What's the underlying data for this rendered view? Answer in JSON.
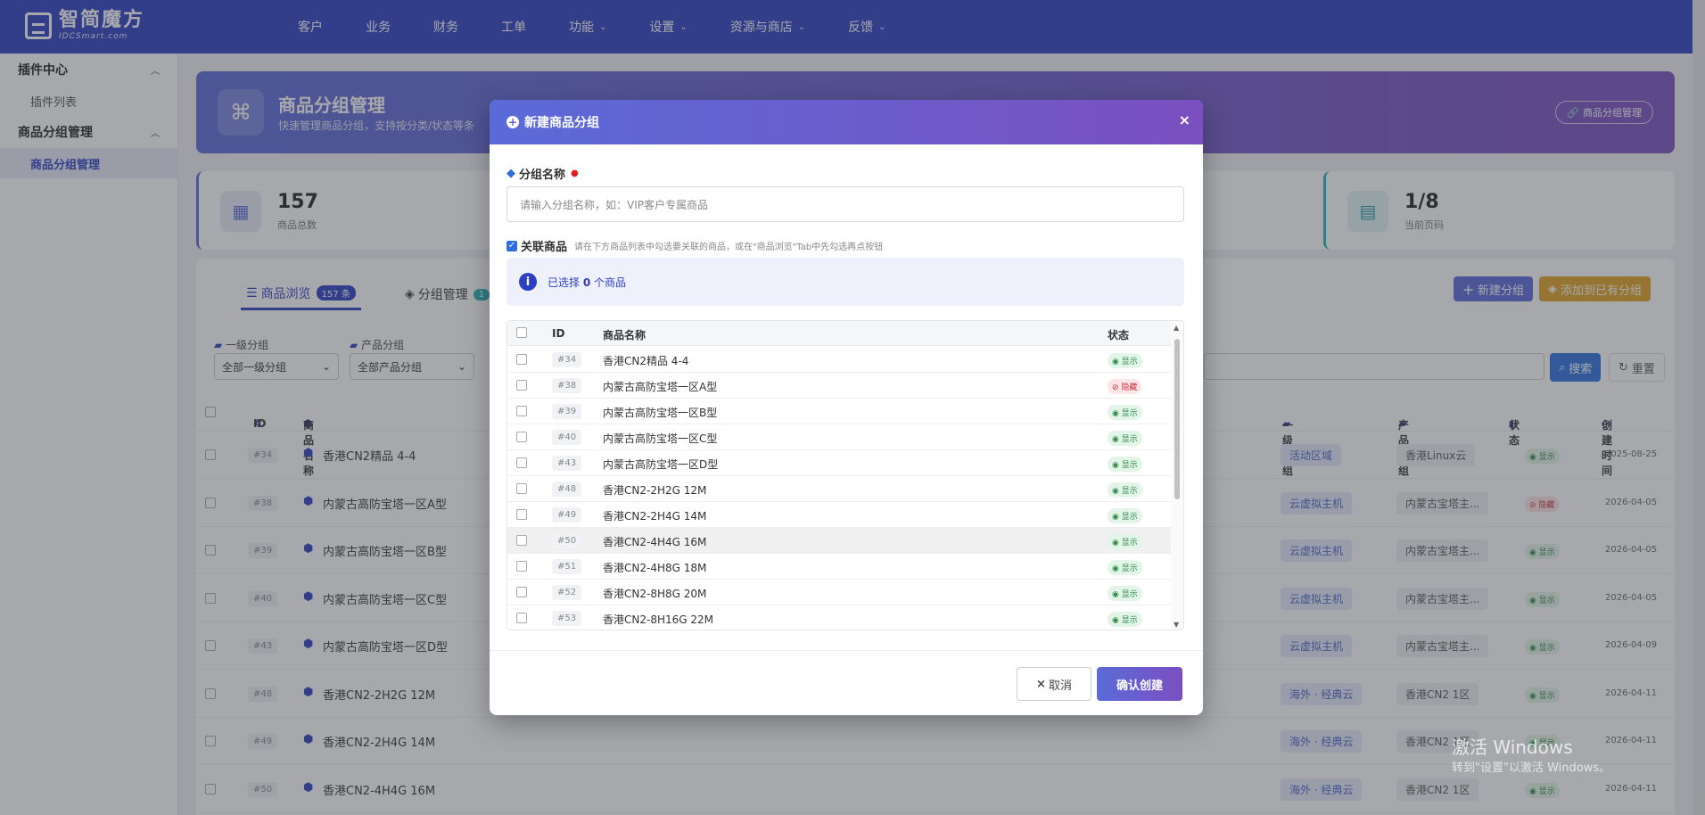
{
  "brand": {
    "name": "智简魔方",
    "sub": "IDCSmart.com"
  },
  "topnav": {
    "items": [
      {
        "label": "客户",
        "has_dropdown": false
      },
      {
        "label": "业务",
        "has_dropdown": false
      },
      {
        "label": "财务",
        "has_dropdown": false
      },
      {
        "label": "工单",
        "has_dropdown": false
      },
      {
        "label": "功能",
        "has_dropdown": true
      },
      {
        "label": "设置",
        "has_dropdown": true
      },
      {
        "label": "资源与商店",
        "has_dropdown": true
      },
      {
        "label": "反馈",
        "has_dropdown": true
      }
    ]
  },
  "sidebar": {
    "groups": [
      {
        "label": "插件中心",
        "items": [
          {
            "label": "插件列表",
            "active": false
          }
        ]
      },
      {
        "label": "商品分组管理",
        "items": [
          {
            "label": "商品分组管理",
            "active": true
          }
        ]
      }
    ]
  },
  "header": {
    "title": "商品分组管理",
    "subtitle": "快速管理商品分组，支持按分类/状态等条",
    "button": "商品分组管理"
  },
  "stats": [
    {
      "value": "157",
      "label": "商品总数"
    },
    {
      "value": "1/8",
      "label": "当前页码"
    }
  ],
  "tabs": [
    {
      "label": "商品浏览",
      "badge": "157 条"
    },
    {
      "label": "分组管理",
      "badge": "1"
    }
  ],
  "actions": {
    "new_group": "新建分组",
    "add_existing": "添加到已有分组"
  },
  "filters": {
    "level1_label": "一级分组",
    "level1_value": "全部一级分组",
    "product_label": "产品分组",
    "product_value": "全部产品分组",
    "search": "搜索",
    "reset": "重置"
  },
  "table": {
    "headers": {
      "id": "ID",
      "name": "商品名称",
      "level1": "一级分组",
      "product_group": "产品分组",
      "status": "状态",
      "created": "创建时间"
    },
    "rows": [
      {
        "id": "#34",
        "name": "香港CN2精品 4-4",
        "level1": "活动区域",
        "product_group": "香港Linux云",
        "status": "显示",
        "created": "2025-08-25"
      },
      {
        "id": "#38",
        "name": "内蒙古高防宝塔一区A型",
        "level1": "云虚拟主机",
        "product_group": "内蒙古宝塔主...",
        "status": "隐藏",
        "created": "2026-04-05"
      },
      {
        "id": "#39",
        "name": "内蒙古高防宝塔一区B型",
        "level1": "云虚拟主机",
        "product_group": "内蒙古宝塔主...",
        "status": "显示",
        "created": "2026-04-05"
      },
      {
        "id": "#40",
        "name": "内蒙古高防宝塔一区C型",
        "level1": "云虚拟主机",
        "product_group": "内蒙古宝塔主...",
        "status": "显示",
        "created": "2026-04-05"
      },
      {
        "id": "#43",
        "name": "内蒙古高防宝塔一区D型",
        "level1": "云虚拟主机",
        "product_group": "内蒙古宝塔主...",
        "status": "显示",
        "created": "2026-04-09"
      },
      {
        "id": "#48",
        "name": "香港CN2-2H2G 12M",
        "level1": "海外 · 经典云",
        "product_group": "香港CN2 1区",
        "status": "显示",
        "created": "2026-04-11"
      },
      {
        "id": "#49",
        "name": "香港CN2-2H4G 14M",
        "level1": "海外 · 经典云",
        "product_group": "香港CN2 1区",
        "status": "显示",
        "created": "2026-04-11"
      },
      {
        "id": "#50",
        "name": "香港CN2-4H4G 16M",
        "level1": "海外 · 经典云",
        "product_group": "香港CN2 1区",
        "status": "显示",
        "created": "2026-04-11"
      }
    ]
  },
  "watermark": {
    "line1": "激活 Windows",
    "line2": "转到\"设置\"以激活 Windows。"
  },
  "modal": {
    "title": "新建商品分组",
    "name_label": "分组名称",
    "name_placeholder": "请输入分组名称，如：VIP客户专属商品",
    "assoc_label": "关联商品",
    "assoc_hint": "请在下方商品列表中勾选要关联的商品，或在\"商品浏览\"Tab中先勾选再点按钮",
    "selected_prefix": "已选择",
    "selected_count": "0",
    "selected_suffix": "个商品",
    "list_headers": {
      "id": "ID",
      "name": "商品名称",
      "status": "状态"
    },
    "list": [
      {
        "id": "#34",
        "name": "香港CN2精品 4-4",
        "status": "显示"
      },
      {
        "id": "#38",
        "name": "内蒙古高防宝塔一区A型",
        "status": "隐藏"
      },
      {
        "id": "#39",
        "name": "内蒙古高防宝塔一区B型",
        "status": "显示"
      },
      {
        "id": "#40",
        "name": "内蒙古高防宝塔一区C型",
        "status": "显示"
      },
      {
        "id": "#43",
        "name": "内蒙古高防宝塔一区D型",
        "status": "显示"
      },
      {
        "id": "#48",
        "name": "香港CN2-2H2G 12M",
        "status": "显示"
      },
      {
        "id": "#49",
        "name": "香港CN2-2H4G 14M",
        "status": "显示"
      },
      {
        "id": "#50",
        "name": "香港CN2-4H4G 16M",
        "status": "显示"
      },
      {
        "id": "#51",
        "name": "香港CN2-4H8G 18M",
        "status": "显示"
      },
      {
        "id": "#52",
        "name": "香港CN2-8H8G 20M",
        "status": "显示"
      },
      {
        "id": "#53",
        "name": "香港CN2-8H16G 22M",
        "status": "显示"
      }
    ],
    "cancel": "取消",
    "confirm": "确认创建"
  },
  "colors": {
    "primary": "#2d3ec2",
    "gradient_start": "#5a6bd8",
    "gradient_end": "#7b4fc0",
    "show": "#2b8a47",
    "hide": "#c8343f"
  }
}
